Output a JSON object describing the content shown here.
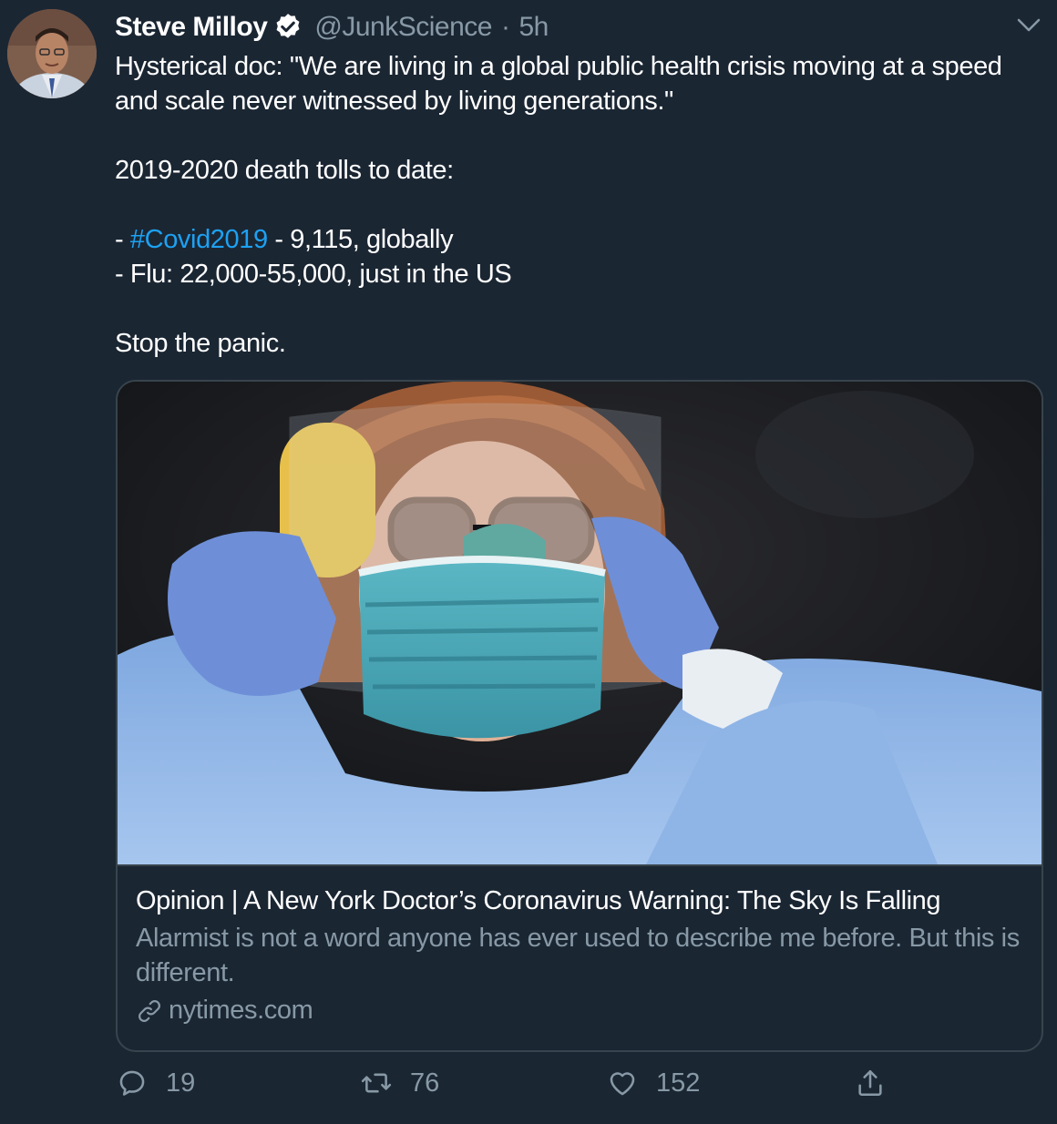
{
  "author": {
    "display_name": "Steve Milloy",
    "handle": "@JunkScience",
    "separator": "·",
    "time": "5h",
    "verified": true
  },
  "tweet": {
    "line1": "Hysterical doc: \"We are living in a global public health crisis moving at a speed and scale never witnessed by living generations.\"",
    "line2": "2019-2020 death tolls to date:",
    "line3_prefix": "- ",
    "line3_hashtag": "#Covid2019",
    "line3_suffix": " - 9,115, globally",
    "line4": "- Flu: 22,000-55,000, just in the US",
    "line5": "Stop the panic."
  },
  "card": {
    "title": "Opinion | A New York Doctor’s Coronavirus Warning: The Sky Is Falling",
    "description": "Alarmist is not a word anyone has ever used to describe me before. But this is different.",
    "domain": "nytimes.com"
  },
  "actions": {
    "replies": "19",
    "retweets": "76",
    "likes": "152"
  },
  "colors": {
    "background": "#1b2633",
    "secondary_text": "#8899a6",
    "link": "#1da1f2",
    "border": "#38444d"
  }
}
